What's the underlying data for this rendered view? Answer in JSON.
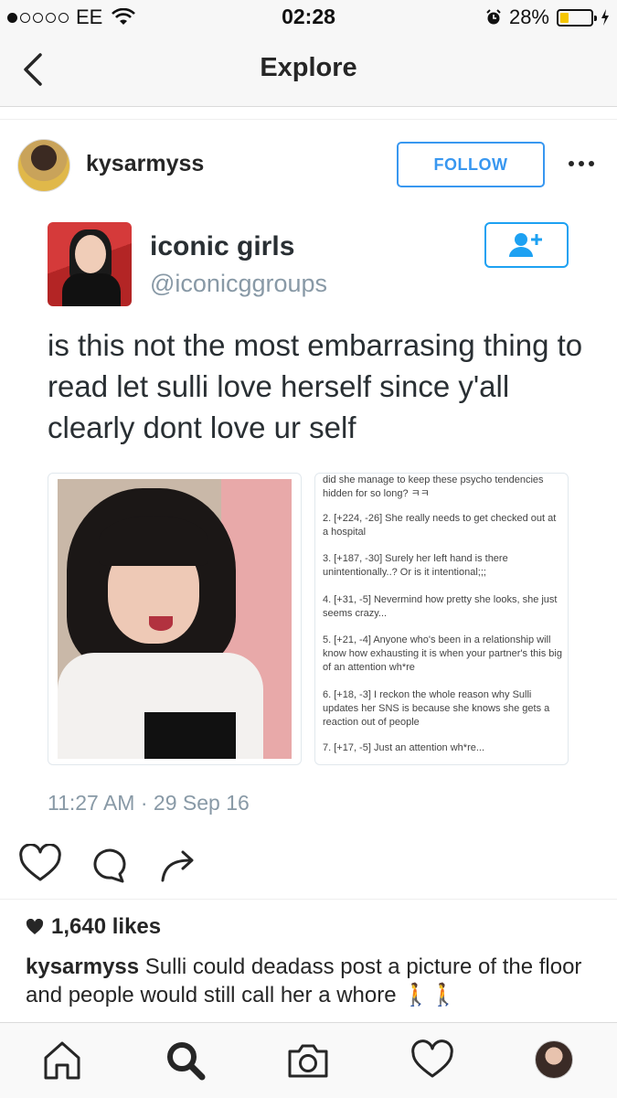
{
  "status_bar": {
    "carrier": "EE",
    "time": "02:28",
    "battery_percent": "28%",
    "battery_level": 0.28,
    "signal_bars_filled": 1,
    "signal_bars_total": 5
  },
  "nav": {
    "title": "Explore",
    "back_icon": "chevron-left-icon"
  },
  "post": {
    "username": "kysarmyss",
    "follow_label": "FOLLOW",
    "more_icon": "more-horizontal-icon",
    "image": {
      "tweet_name": "iconic girls",
      "tweet_handle": "@iconicggroups",
      "tweet_text": "is this not the most embarrasing thing to read let sulli love herself since y'all clearly dont love ur self",
      "tweet_follow_icon": "add-user-icon",
      "comments": [
        "did she manage to keep these psycho tendencies hidden for so long? ㅋㅋ",
        "2. [+224, -26] She really needs to get checked out at a hospital",
        "3. [+187, -30] Surely her left hand is there unintentionally..? Or is it intentional;;;",
        "4. [+31, -5] Nevermind how pretty she looks, she just seems crazy...",
        "5. [+21, -4] Anyone who's been in a relationship will know how exhausting it is when your partner's this big of an attention wh*re",
        "6. [+18, -3] I reckon the whole reason why Sulli updates her SNS is because she knows she gets a reaction out of people",
        "7. [+17, -5] Just an attention wh*re..."
      ],
      "tweet_timestamp": "11:27 AM · 29 Sep 16"
    },
    "actions": {
      "like_icon": "heart-icon",
      "comment_icon": "comment-icon",
      "share_icon": "share-icon"
    },
    "likes": "1,640 likes",
    "caption_user": "kysarmyss",
    "caption_text": "Sulli could deadass post a picture of the floor and people would still call her a whore 🚶🚶"
  },
  "tabbar": {
    "home_icon": "home-icon",
    "search_icon": "search-icon",
    "camera_icon": "camera-icon",
    "activity_icon": "heart-icon",
    "profile_icon": "profile-avatar"
  },
  "colors": {
    "accent": "#3897f0",
    "twitter_blue": "#1da1f2",
    "battery_fill": "#f5c600",
    "text": "#262626",
    "muted": "#8899a6"
  }
}
